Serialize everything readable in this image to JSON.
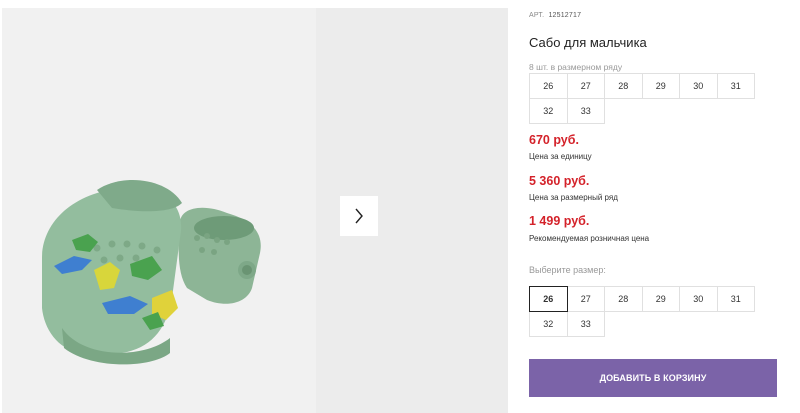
{
  "product": {
    "sku_label": "АРТ.",
    "sku_code": "12512717",
    "title": "Сабо для мальчика",
    "image_alt_icon": "clog-shoes-image"
  },
  "pack": {
    "note": "8 шт. в размерном ряду",
    "sizes": [
      "26",
      "27",
      "28",
      "29",
      "30",
      "31",
      "32",
      "33"
    ]
  },
  "prices": [
    {
      "value": "670 руб.",
      "label": "Цена за единицу"
    },
    {
      "value": "5 360 руб.",
      "label": "Цена за размерный ряд"
    },
    {
      "value": "1 499 руб.",
      "label": "Рекомендуемая розничная цена"
    }
  ],
  "choose": {
    "label": "Выберите размер:",
    "sizes": [
      "26",
      "27",
      "28",
      "29",
      "30",
      "31",
      "32",
      "33"
    ],
    "selected": "26"
  },
  "cart_button": {
    "label": "ДОБАВИТЬ В КОРЗИНУ"
  },
  "colors": {
    "price": "#d4222a",
    "accent": "#7b63a8",
    "shoe": "#8fb99a"
  }
}
